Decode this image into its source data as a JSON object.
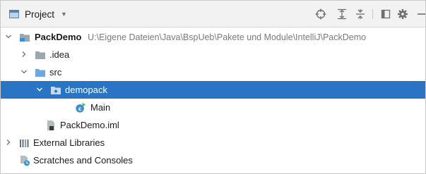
{
  "panel": {
    "title": "Project",
    "toolbar": {
      "locate_icon": "crosshair-icon",
      "expand_icon": "expand-all-icon",
      "collapse_icon": "collapse-all-icon",
      "layout_icon": "layout-icon",
      "settings_icon": "gear-icon",
      "hide_icon": "minimize-icon"
    }
  },
  "tree": {
    "root": {
      "label": "PackDemo",
      "path": "U:\\Eigene Dateien\\Java\\BspUeb\\Pakete und Module\\IntelliJ\\PackDemo",
      "expanded": true
    },
    "idea": {
      "label": ".idea",
      "expanded": false
    },
    "src": {
      "label": "src",
      "expanded": true
    },
    "demopack": {
      "label": "demopack",
      "expanded": true,
      "selected": true
    },
    "main": {
      "label": "Main"
    },
    "iml": {
      "label": "PackDemo.iml"
    },
    "libraries": {
      "label": "External Libraries",
      "expanded": false
    },
    "scratches": {
      "label": "Scratches and Consoles"
    }
  },
  "colors": {
    "selection": "#2a74c6",
    "folder": "#9aa7b0",
    "source_folder": "#6fa8dc",
    "class_icon": "#3d8fd1",
    "run_marker": "#59a869"
  }
}
